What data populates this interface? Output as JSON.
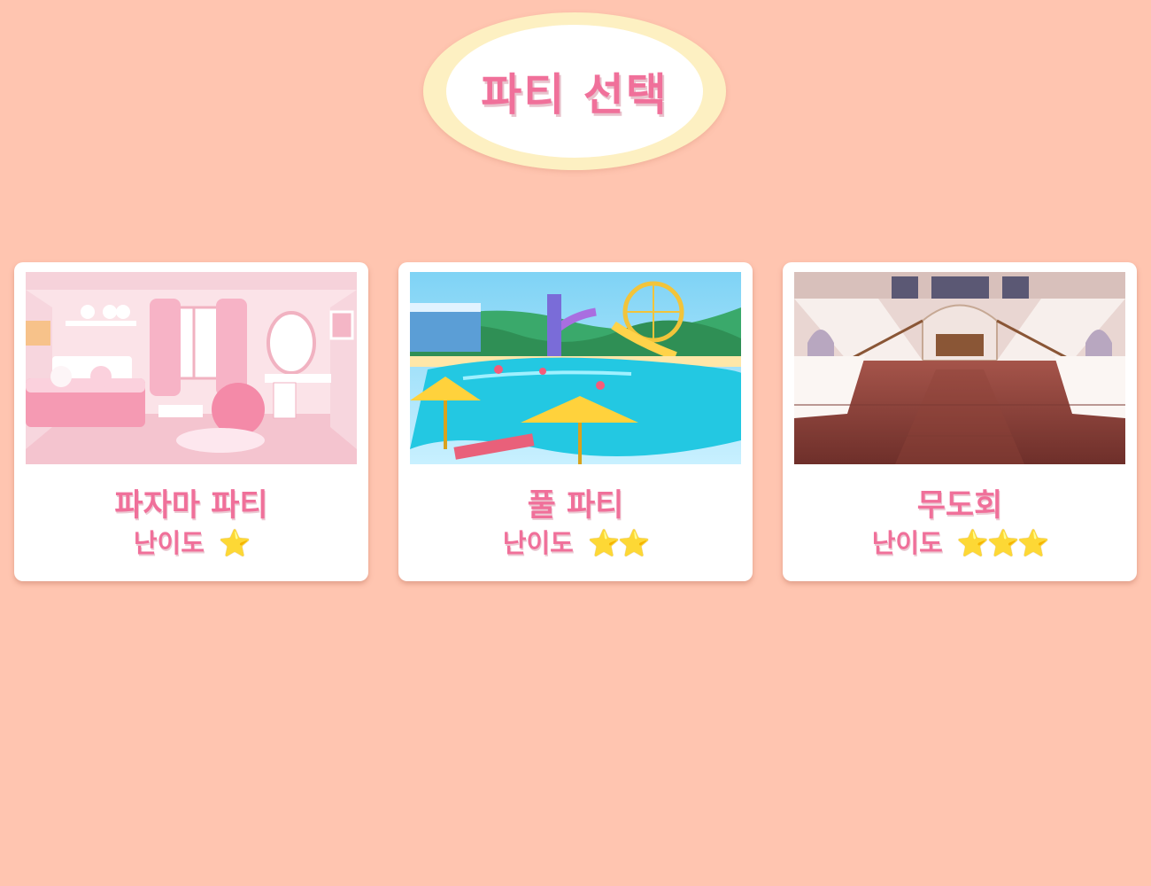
{
  "header": {
    "title": "파티 선택"
  },
  "parties": [
    {
      "name": "파자마 파티",
      "difficulty_label": "난이도",
      "difficulty": 1,
      "stars": "⭐",
      "image": "pink-bedroom-illustration"
    },
    {
      "name": "풀 파티",
      "difficulty_label": "난이도",
      "difficulty": 2,
      "stars": "⭐⭐",
      "image": "waterpark-pool-illustration"
    },
    {
      "name": "무도회",
      "difficulty_label": "난이도",
      "difficulty": 3,
      "stars": "⭐⭐⭐",
      "image": "ballroom-hall-illustration"
    }
  ],
  "colors": {
    "background": "#ffc5b0",
    "accent": "#f0709a",
    "badge": "#fdf0c2",
    "card": "#ffffff"
  }
}
